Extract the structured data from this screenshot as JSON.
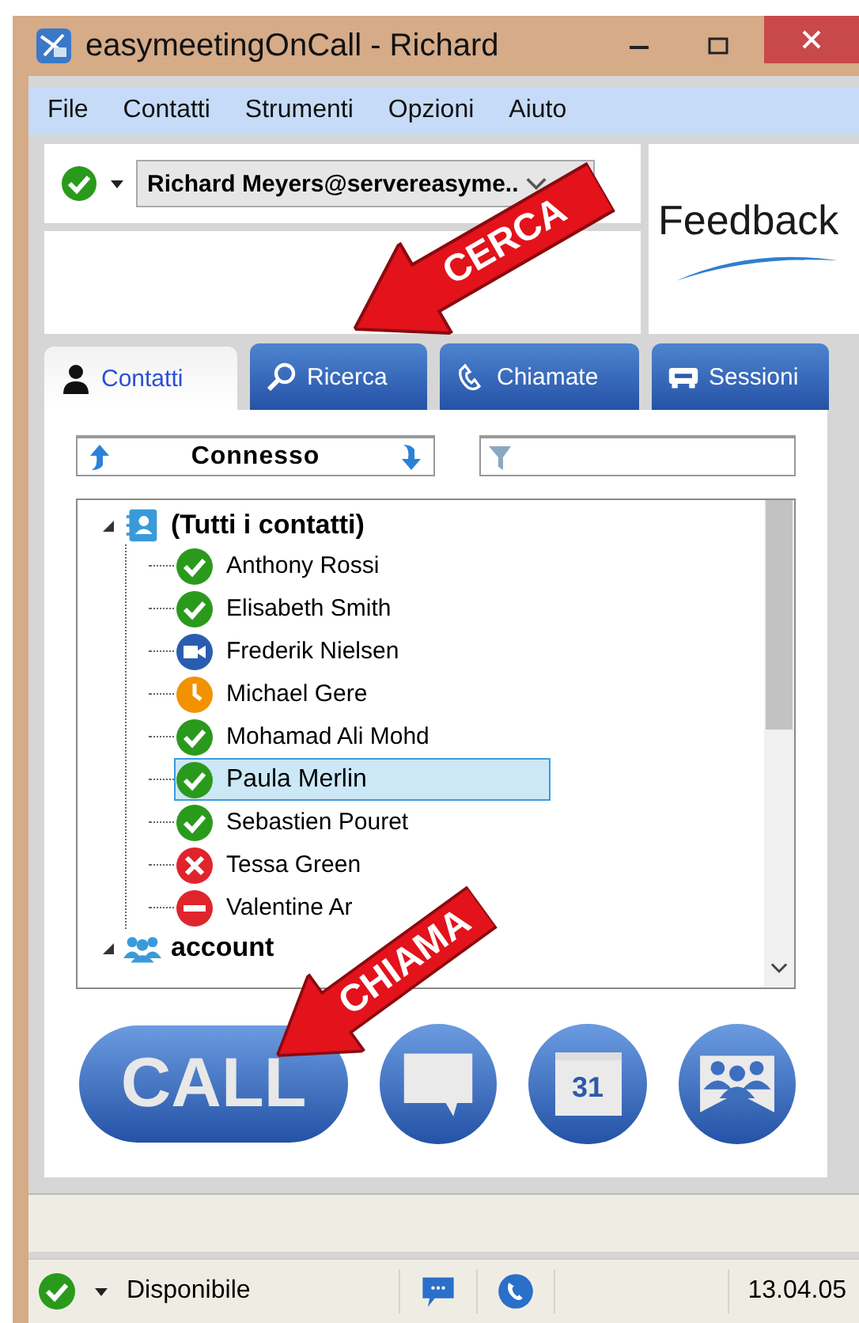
{
  "window": {
    "title": "easymeetingOnCall - Richard"
  },
  "menu": [
    "File",
    "Contatti",
    "Strumenti",
    "Opzioni",
    "Aiuto"
  ],
  "account": {
    "kind": "online",
    "name": "Richard Meyers@servereasyme.."
  },
  "banner": {
    "text": "Feedback"
  },
  "tabs": [
    {
      "label": "Contatti",
      "kind": "person",
      "selected": true
    },
    {
      "label": "Ricerca",
      "kind": "search",
      "selected": false
    },
    {
      "label": "Chiamate",
      "kind": "phone",
      "selected": false
    },
    {
      "label": "Sessioni",
      "kind": "session",
      "selected": false
    }
  ],
  "sort": {
    "value": "Connesso"
  },
  "tree": [
    {
      "label": "(Tutti i contatti)",
      "kind": "contacts",
      "expanded": true,
      "children": [
        {
          "name": "Anthony Rossi",
          "kind": "online",
          "selected": false
        },
        {
          "name": "Elisabeth Smith",
          "kind": "online",
          "selected": false
        },
        {
          "name": "Frederik Nielsen",
          "kind": "video",
          "selected": false
        },
        {
          "name": "Michael Gere",
          "kind": "away",
          "selected": false
        },
        {
          "name": "Mohamad Ali Mohd",
          "kind": "online",
          "selected": false
        },
        {
          "name": "Paula Merlin",
          "kind": "online",
          "selected": true
        },
        {
          "name": "Sebastien Pouret",
          "kind": "online",
          "selected": false
        },
        {
          "name": "Tessa Green",
          "kind": "busy",
          "selected": false
        },
        {
          "name": "Valentine Ar",
          "kind": "dnd",
          "selected": false
        }
      ]
    },
    {
      "label": "account",
      "kind": "group",
      "expanded": true
    }
  ],
  "actions": [
    {
      "kind": "call",
      "label": "CALL"
    },
    {
      "kind": "chat"
    },
    {
      "kind": "calendar",
      "label": "31"
    },
    {
      "kind": "meeting"
    }
  ],
  "status_bar": {
    "kind": "online",
    "label": "Disponibile",
    "time": "13.04.05"
  },
  "annotations": [
    {
      "text": "CERCA"
    },
    {
      "text": "CHIAMA"
    }
  ]
}
